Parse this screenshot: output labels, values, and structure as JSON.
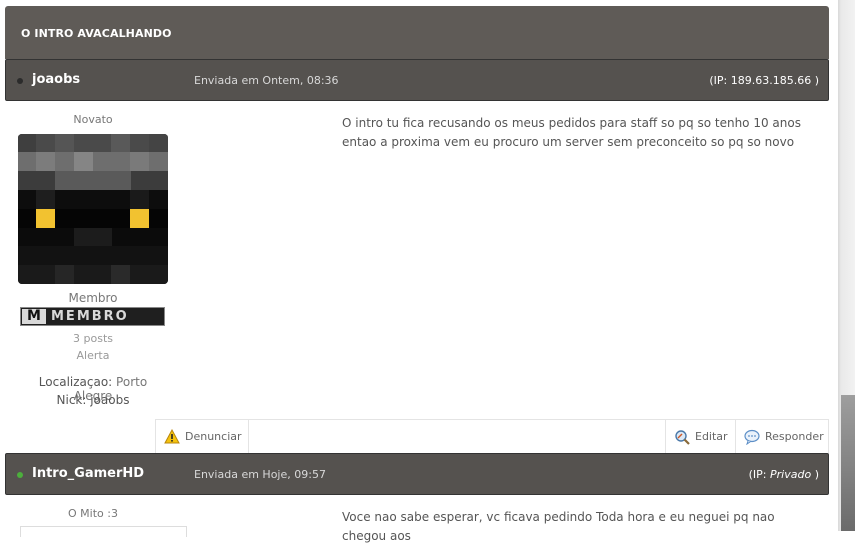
{
  "topic": {
    "title": "O INTRO AVACALHANDO"
  },
  "posts": [
    {
      "author": "joaobs",
      "date": "Enviada em Ontem, 08:36",
      "ip_prefix": "(IP: ",
      "ip_value": "189.63.185.66",
      "ip_suffix": " )",
      "online": false,
      "rank_title": "Novato",
      "group": "Membro",
      "rank_badge": {
        "letter": "M",
        "text": "MEMBRO"
      },
      "posts_count": "3 posts",
      "warning": "Alerta",
      "location_label": "Localizaçao: ",
      "location_value": "Porto Alegre",
      "nick_label": "Nick: ",
      "nick_value": "joaobs",
      "body": "O intro tu fica recusando os meus pedidos para staff so pq so tenho 10 anos entao a proxima vem eu procuro um server sem preconceito so pq so novo",
      "actions": {
        "report": "Denunciar",
        "edit": "Editar",
        "reply": "Responder"
      }
    },
    {
      "author": "Intro_GamerHD",
      "date": "Enviada em Hoje, 09:57",
      "ip_prefix": "(IP: ",
      "ip_value": "Privado",
      "ip_suffix": " )",
      "online": true,
      "rank_title": "O Mito :3",
      "body": "Voce nao sabe esperar, vc ficava pedindo Toda hora e eu neguei pq nao chegou aos"
    }
  ],
  "colors": {
    "header_bg": "#55524f",
    "topic_bg": "#5f5b57",
    "online": "#4caf3c",
    "offline": "#2b2b2b",
    "avatar_eyes": "#f2c230"
  },
  "icons": [
    "warning-icon",
    "edit-icon",
    "reply-icon",
    "status-dot-icon"
  ]
}
